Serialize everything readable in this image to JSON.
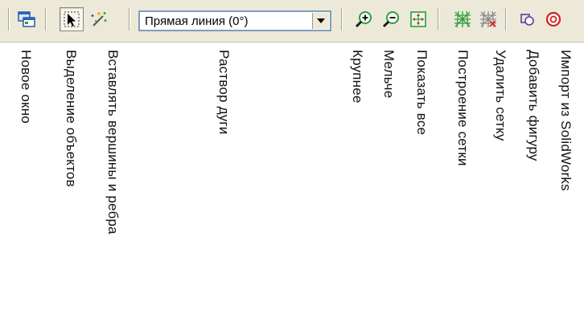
{
  "toolbar": {
    "line_type_select": {
      "value": "Прямая линия (0°)"
    },
    "buttons": {
      "new_window": "new-window-icon",
      "select_objects": "select-arrow-icon",
      "insert_vertices_edges": "magic-wand-icon",
      "zoom_in": "zoom-in-icon",
      "zoom_out": "zoom-out-icon",
      "show_all": "fit-all-icon",
      "build_mesh": "build-mesh-icon",
      "delete_mesh": "delete-mesh-icon",
      "add_shape": "add-shape-icon",
      "import_solidworks": "import-icon"
    }
  },
  "labels": {
    "new_window": "Новое окно",
    "select_objects": "Выделение объектов",
    "insert_vertices_edges": "Вставлять вершины и ребра",
    "arc_angle": "Раствор дуги",
    "zoom_in": "Крупнее",
    "zoom_out": "Мельче",
    "show_all": "Показать все",
    "build_mesh": "Построение сетки",
    "delete_mesh": "Удалить сетку",
    "add_shape": "Добавить фигуру",
    "import_solidworks": "Импорт из SolidWorks"
  },
  "colors": {
    "toolbar_bg": "#ece9d8",
    "mesh_green": "#2e9e3a",
    "delete_gray": "#8a8a8a",
    "import_red": "#d62020",
    "icon_blue": "#1f63c5"
  }
}
